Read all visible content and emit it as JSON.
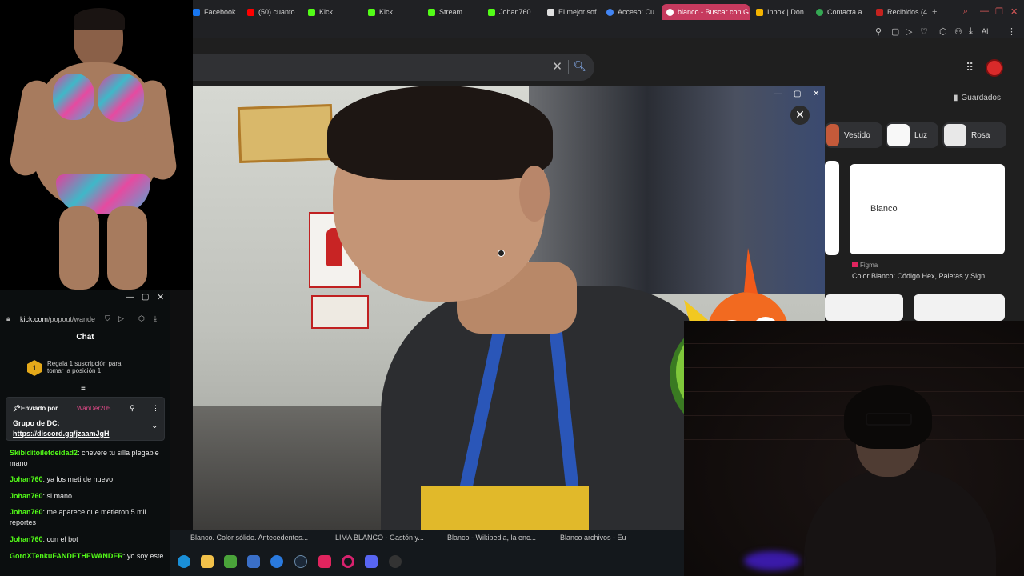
{
  "browser": {
    "tabs": [
      {
        "label": "Facebook",
        "color": "#1877f2"
      },
      {
        "label": "(50) cuanto",
        "color": "#ff0000"
      },
      {
        "label": "Kick",
        "color": "#53fc18"
      },
      {
        "label": "Kick",
        "color": "#53fc18"
      },
      {
        "label": "Stream",
        "color": "#53fc18"
      },
      {
        "label": "Johan760",
        "color": "#53fc18"
      },
      {
        "label": "El mejor sof",
        "color": "#e0e0e0"
      },
      {
        "label": "Acceso: Cu",
        "color": "#4285f4"
      },
      {
        "label": "blanco - Buscar con G",
        "color": "#ffffff"
      },
      {
        "label": "Inbox | Don",
        "color": "#f4b400"
      },
      {
        "label": "Contacta a",
        "color": "#34a853"
      },
      {
        "label": "Recibidos (4",
        "color": "#c5221f"
      }
    ],
    "new_tab": "+",
    "toolbar_icons": [
      "pin-icon",
      "tabs-icon",
      "play-icon",
      "heart-icon",
      "extension-icon",
      "profile-icon",
      "download-icon"
    ],
    "ai_label": "AI",
    "menu": "⋮"
  },
  "google": {
    "saved_label": "Guardados",
    "chips": [
      {
        "label": "Vestido",
        "color": "#c45a3a"
      },
      {
        "label": "Luz",
        "color": "#f8f8f8"
      },
      {
        "label": "Rosa",
        "color": "#e8e8e8"
      }
    ],
    "result_card_title": "Blanco",
    "result_source": "Figma",
    "result_title": "Color Blanco: Código Hex, Paletas y Sign..."
  },
  "chat": {
    "url_domain": "kick.com",
    "url_path": "/popout/wande",
    "title": "Chat",
    "gift_rank": "1",
    "gift_text": "Regala 1 suscripción para tomar la posición 1",
    "pinned_by_label": "Enviado por",
    "pinned_user": "WanDer205",
    "pinned_msg_title": "Grupo de DC:",
    "pinned_msg_link": "https://discord.gg/jzaamJgH",
    "messages": [
      {
        "user": "Skibiditoiletdeidad2",
        "text": "chevere tu silla plegable mano"
      },
      {
        "user": "Johan760",
        "text": "ya los meti de nuevo"
      },
      {
        "user": "Johan760",
        "text": "si mano"
      },
      {
        "user": "Johan760",
        "text": "me aparece que metieron 5 mil reportes"
      },
      {
        "user": "Johan760",
        "text": "con el bot"
      },
      {
        "user": "GordXTenkuFANDETHEWANDER",
        "text": "yo soy este"
      }
    ]
  },
  "taskbar": {
    "tabs": [
      "Blanco. Color sólido. Antecedentes...",
      "LIMA BLANCO - Gastón y...",
      "Blanco - Wikipedia, la enc...",
      "Blanco archivos - Eu"
    ],
    "icons": [
      {
        "name": "edge-icon",
        "color": "#1a8fd8"
      },
      {
        "name": "folder-icon",
        "color": "#f2c14a"
      },
      {
        "name": "minecraft-icon",
        "color": "#4aa33a"
      },
      {
        "name": "calculator-icon",
        "color": "#3a6fc8"
      },
      {
        "name": "browser-icon",
        "color": "#2a7adf"
      },
      {
        "name": "steam-icon",
        "color": "#1b2838"
      },
      {
        "name": "tiktok-icon",
        "color": "#e0245e"
      },
      {
        "name": "opera-icon",
        "color": "#d8226e"
      },
      {
        "name": "discord-icon",
        "color": "#5865f2"
      },
      {
        "name": "app-icon",
        "color": "#333333"
      }
    ]
  }
}
